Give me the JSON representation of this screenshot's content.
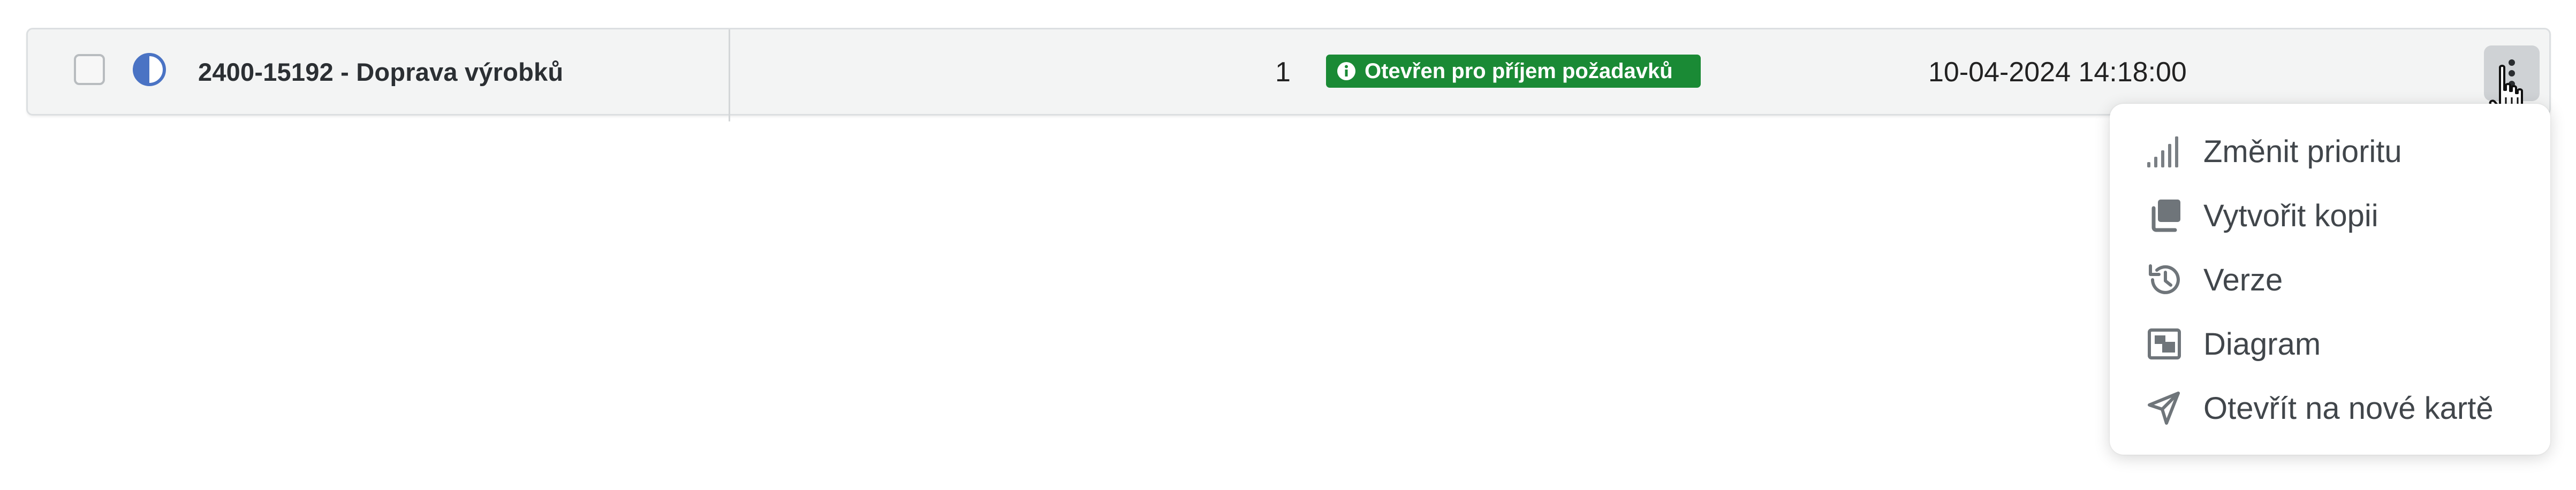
{
  "row": {
    "title": "2400-15192 - Doprava výrobků",
    "count": "1",
    "status_badge": "Otevřen pro příjem požadavků",
    "date": "10-04-2024 14:18:00",
    "priority_icon": "half-circle-icon",
    "badge_color": "#1a8a35"
  },
  "menu": {
    "items": [
      {
        "label": "Změnit prioritu",
        "icon": "signal-bars-icon"
      },
      {
        "label": "Vytvořit kopii",
        "icon": "copy-icon"
      },
      {
        "label": "Verze",
        "icon": "history-icon"
      },
      {
        "label": "Diagram",
        "icon": "diagram-icon"
      },
      {
        "label": "Otevřít na nové kartě",
        "icon": "send-arrow-icon"
      }
    ]
  }
}
